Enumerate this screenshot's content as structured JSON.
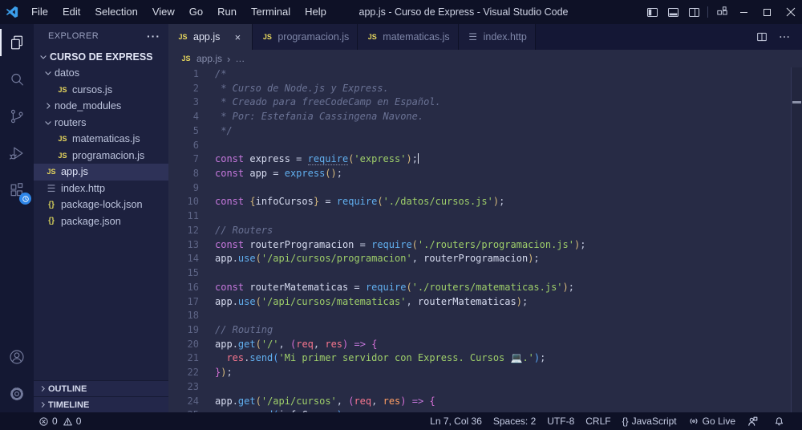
{
  "window": {
    "title": "app.js - Curso de Express - Visual Studio Code",
    "controls": [
      "minimize",
      "maximize",
      "close"
    ],
    "layout_icons": [
      "layout-sidebar-left",
      "layout-panel-bottom",
      "layout-sidebar-right",
      "customize-layout"
    ]
  },
  "menu_bar": [
    "File",
    "Edit",
    "Selection",
    "View",
    "Go",
    "Run",
    "Terminal",
    "Help"
  ],
  "activity_bar": {
    "top": [
      {
        "id": "explorer",
        "icon": "files-icon",
        "active": true
      },
      {
        "id": "search",
        "icon": "search-icon",
        "active": false
      },
      {
        "id": "source-control",
        "icon": "source-control-icon",
        "active": false
      },
      {
        "id": "run-debug",
        "icon": "run-debug-icon",
        "active": false
      },
      {
        "id": "extensions",
        "icon": "extensions-icon",
        "active": false,
        "badge": "clock"
      }
    ],
    "bottom": [
      {
        "id": "account",
        "icon": "account-icon"
      },
      {
        "id": "settings",
        "icon": "gear-icon"
      }
    ]
  },
  "sidebar": {
    "header": "EXPLORER",
    "more_label": "···",
    "root": "CURSO DE EXPRESS",
    "tree": [
      {
        "label": "datos",
        "type": "folder",
        "state": "open",
        "depth": 1
      },
      {
        "label": "cursos.js",
        "type": "js",
        "depth": 2
      },
      {
        "label": "node_modules",
        "type": "folder",
        "state": "closed",
        "depth": 1
      },
      {
        "label": "routers",
        "type": "folder",
        "state": "open",
        "depth": 1
      },
      {
        "label": "matematicas.js",
        "type": "js",
        "depth": 2
      },
      {
        "label": "programacion.js",
        "type": "js",
        "depth": 2
      },
      {
        "label": "app.js",
        "type": "js",
        "depth": 1,
        "selected": true
      },
      {
        "label": "index.http",
        "type": "http",
        "depth": 1
      },
      {
        "label": "package-lock.json",
        "type": "json",
        "depth": 1
      },
      {
        "label": "package.json",
        "type": "json",
        "depth": 1
      }
    ],
    "bottom_sections": [
      "OUTLINE",
      "TIMELINE"
    ]
  },
  "editor": {
    "tabs": [
      {
        "label": "app.js",
        "icon": "js",
        "active": true,
        "close": "×"
      },
      {
        "label": "programacion.js",
        "icon": "js",
        "active": false
      },
      {
        "label": "matematicas.js",
        "icon": "js",
        "active": false
      },
      {
        "label": "index.http",
        "icon": "http",
        "active": false
      }
    ],
    "breadcrumb": {
      "file": "app.js",
      "separator": "›",
      "rest": "…"
    },
    "code_lines": [
      {
        "n": 1,
        "t": [
          [
            "cm",
            "/*"
          ]
        ]
      },
      {
        "n": 2,
        "t": [
          [
            "cm",
            " * Curso de Node.js y Express."
          ]
        ]
      },
      {
        "n": 3,
        "t": [
          [
            "cm",
            " * Creado para freeCodeCamp en Español."
          ]
        ]
      },
      {
        "n": 4,
        "t": [
          [
            "cm",
            " * Por: Estefania Cassingena Navone."
          ]
        ]
      },
      {
        "n": 5,
        "t": [
          [
            "cm",
            " */"
          ]
        ]
      },
      {
        "n": 6,
        "t": []
      },
      {
        "n": 7,
        "t": [
          [
            "kw",
            "const "
          ],
          [
            "vr",
            "express "
          ],
          [
            "op",
            "= "
          ],
          [
            "fnh",
            "require"
          ],
          [
            "b1",
            "("
          ],
          [
            "st",
            "'express'"
          ],
          [
            "b1",
            ")"
          ],
          [
            "pu",
            ";"
          ],
          [
            "caret",
            ""
          ]
        ]
      },
      {
        "n": 8,
        "t": [
          [
            "kw",
            "const "
          ],
          [
            "vr",
            "app "
          ],
          [
            "op",
            "= "
          ],
          [
            "fn",
            "express"
          ],
          [
            "b1",
            "()"
          ],
          [
            "pu",
            ";"
          ]
        ]
      },
      {
        "n": 9,
        "t": []
      },
      {
        "n": 10,
        "t": [
          [
            "kw",
            "const "
          ],
          [
            "b1",
            "{"
          ],
          [
            "vr",
            "infoCursos"
          ],
          [
            "b1",
            "}"
          ],
          [
            "pu",
            " "
          ],
          [
            "op",
            "= "
          ],
          [
            "fn",
            "require"
          ],
          [
            "b1",
            "("
          ],
          [
            "st",
            "'./datos/cursos.js'"
          ],
          [
            "b1",
            ")"
          ],
          [
            "pu",
            ";"
          ]
        ]
      },
      {
        "n": 11,
        "t": []
      },
      {
        "n": 12,
        "t": [
          [
            "cm",
            "// Routers"
          ]
        ]
      },
      {
        "n": 13,
        "t": [
          [
            "kw",
            "const "
          ],
          [
            "vr",
            "routerProgramacion "
          ],
          [
            "op",
            "= "
          ],
          [
            "fn",
            "require"
          ],
          [
            "b1",
            "("
          ],
          [
            "st",
            "'./routers/programacion.js'"
          ],
          [
            "b1",
            ")"
          ],
          [
            "pu",
            ";"
          ]
        ]
      },
      {
        "n": 14,
        "t": [
          [
            "vr",
            "app"
          ],
          [
            "pu",
            "."
          ],
          [
            "fn",
            "use"
          ],
          [
            "b1",
            "("
          ],
          [
            "st",
            "'/api/cursos/programacion'"
          ],
          [
            "pu",
            ", "
          ],
          [
            "vr",
            "routerProgramacion"
          ],
          [
            "b1",
            ")"
          ],
          [
            "pu",
            ";"
          ]
        ]
      },
      {
        "n": 15,
        "t": []
      },
      {
        "n": 16,
        "t": [
          [
            "kw",
            "const "
          ],
          [
            "vr",
            "routerMatematicas "
          ],
          [
            "op",
            "= "
          ],
          [
            "fn",
            "require"
          ],
          [
            "b1",
            "("
          ],
          [
            "st",
            "'./routers/matematicas.js'"
          ],
          [
            "b1",
            ")"
          ],
          [
            "pu",
            ";"
          ]
        ]
      },
      {
        "n": 17,
        "t": [
          [
            "vr",
            "app"
          ],
          [
            "pu",
            "."
          ],
          [
            "fn",
            "use"
          ],
          [
            "b1",
            "("
          ],
          [
            "st",
            "'/api/cursos/matematicas'"
          ],
          [
            "pu",
            ", "
          ],
          [
            "vr",
            "routerMatematicas"
          ],
          [
            "b1",
            ")"
          ],
          [
            "pu",
            ";"
          ]
        ]
      },
      {
        "n": 18,
        "t": []
      },
      {
        "n": 19,
        "t": [
          [
            "cm",
            "// Routing"
          ]
        ]
      },
      {
        "n": 20,
        "t": [
          [
            "vr",
            "app"
          ],
          [
            "pu",
            "."
          ],
          [
            "fn",
            "get"
          ],
          [
            "b1",
            "("
          ],
          [
            "st",
            "'/'"
          ],
          [
            "pu",
            ", "
          ],
          [
            "b2",
            "("
          ],
          [
            "pr",
            "req"
          ],
          [
            "pu",
            ", "
          ],
          [
            "pr",
            "res"
          ],
          [
            "b2",
            ")"
          ],
          [
            "op",
            " "
          ],
          [
            "kw",
            "=>"
          ],
          [
            "op",
            " "
          ],
          [
            "b2",
            "{"
          ]
        ]
      },
      {
        "n": 21,
        "t": [
          [
            "pu",
            "  "
          ],
          [
            "pr",
            "res"
          ],
          [
            "pu",
            "."
          ],
          [
            "fn",
            "send"
          ],
          [
            "b3",
            "("
          ],
          [
            "st",
            "'Mi primer servidor con Express. Cursos 💻.'"
          ],
          [
            "b3",
            ")"
          ],
          [
            "pu",
            ";"
          ]
        ]
      },
      {
        "n": 22,
        "t": [
          [
            "b2",
            "}"
          ],
          [
            "b1",
            ")"
          ],
          [
            "pu",
            ";"
          ]
        ]
      },
      {
        "n": 23,
        "t": []
      },
      {
        "n": 24,
        "t": [
          [
            "vr",
            "app"
          ],
          [
            "pu",
            "."
          ],
          [
            "fn",
            "get"
          ],
          [
            "b1",
            "("
          ],
          [
            "st",
            "'/api/cursos'"
          ],
          [
            "pu",
            ", "
          ],
          [
            "b2",
            "("
          ],
          [
            "pr",
            "req"
          ],
          [
            "pu",
            ", "
          ],
          [
            "pr2",
            "res"
          ],
          [
            "b2",
            ")"
          ],
          [
            "op",
            " "
          ],
          [
            "kw",
            "=>"
          ],
          [
            "op",
            " "
          ],
          [
            "b2",
            "{"
          ]
        ]
      },
      {
        "n": 25,
        "t": [
          [
            "pu",
            "  "
          ],
          [
            "pr",
            "res"
          ],
          [
            "pu",
            "."
          ],
          [
            "fn",
            "send"
          ],
          [
            "b3",
            "("
          ],
          [
            "vr",
            "infoCursos"
          ],
          [
            "b3",
            ")"
          ],
          [
            "pu",
            ";"
          ]
        ]
      }
    ]
  },
  "status_bar": {
    "left": [
      {
        "id": "problems-errors",
        "icon": "error-icon",
        "label": "0"
      },
      {
        "id": "problems-warnings",
        "icon": "warning-icon",
        "label": "0"
      }
    ],
    "right": [
      {
        "id": "cursor-position",
        "label": "Ln 7, Col 36"
      },
      {
        "id": "indentation",
        "label": "Spaces: 2"
      },
      {
        "id": "encoding",
        "label": "UTF-8"
      },
      {
        "id": "eol",
        "label": "CRLF"
      },
      {
        "id": "language-mode",
        "label": "JavaScript",
        "prefix": "{}"
      },
      {
        "id": "go-live",
        "label": "Go Live",
        "icon": "broadcast-icon"
      },
      {
        "id": "feedback",
        "label": "",
        "icon": "person-icon"
      },
      {
        "id": "notifications",
        "label": "",
        "icon": "bell-icon"
      }
    ]
  },
  "colors": {
    "titlebar_bg": "#0e1126",
    "editor_bg": "#272b45",
    "sidebar_bg": "#1d213f",
    "activitybar_bg": "#141833",
    "accent_badge": "#2f86e8",
    "keyword": "#c678dd",
    "string": "#9ece6a",
    "function": "#61afef",
    "comment": "#6a7294",
    "js_badge": "#e7d75d"
  }
}
